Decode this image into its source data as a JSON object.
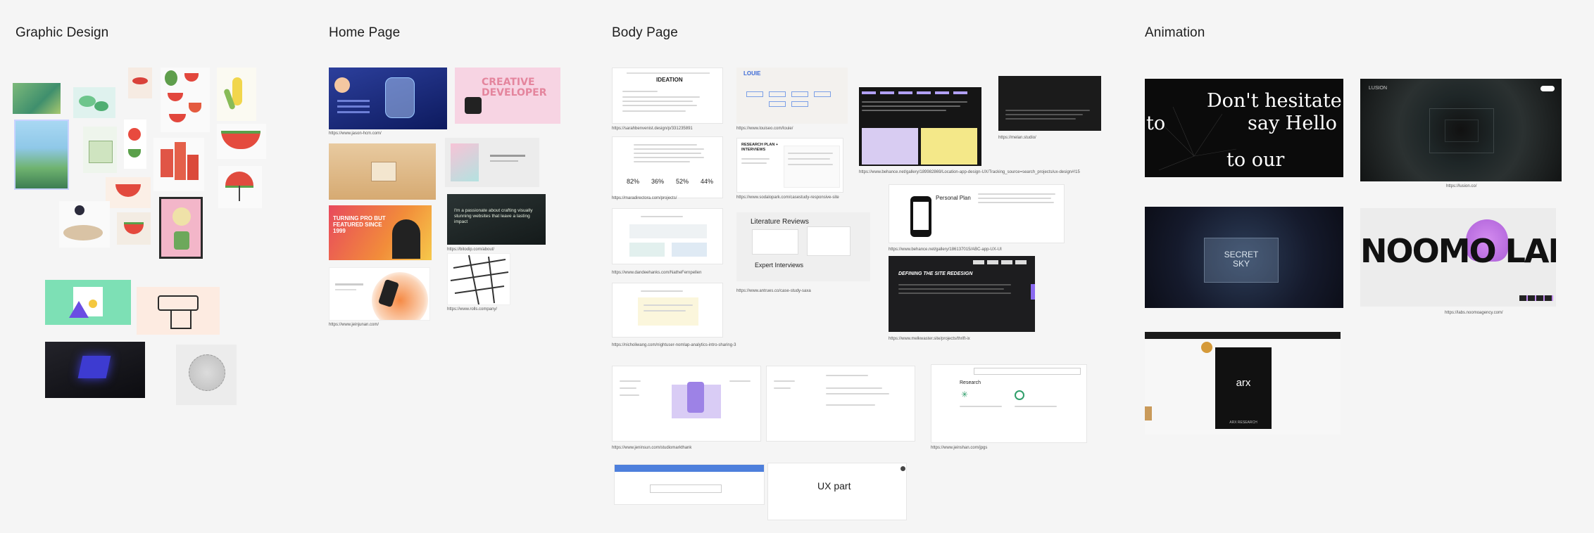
{
  "sections": {
    "graphic": {
      "title": "Graphic Design"
    },
    "home": {
      "title": "Home Page"
    },
    "body": {
      "title": "Body Page"
    },
    "animation": {
      "title": "Animation"
    }
  },
  "home": {
    "creative_text": "CREATIVE DEVELOPER",
    "turning_text": "TURNING PRO BUT FEATURED SINCE 1999",
    "passionate_text": "I'm a passionate about crafting visually stunning websites that leave a lasting impact",
    "captions": {
      "c1": "https://www.jason-hcm.com/",
      "c2": "https://bitodip.com/about/",
      "c3": "https://www.rolls.company/",
      "c4": "https://www.jeinjunan.com/"
    }
  },
  "body": {
    "ideation_title": "IDEATION",
    "louie_title": "LOUIE",
    "research_title": "RESEARCH PLAN + INTERVIEWS",
    "stats": [
      "82%",
      "36%",
      "52%",
      "44%"
    ],
    "lit_review": "Literature Reviews",
    "expert_interviews": "Expert Interviews",
    "personal_plan": "Personal Plan",
    "redesign_title": "DEFINING THE SITE REDESIGN",
    "research_label": "Research",
    "ux_part": "UX part",
    "captions": {
      "c1": "https://sarahbenvenist.design/p/331235891",
      "c2": "https://www.louiseo.com/louie/",
      "c3": "https://www.behance.net/gallery/189982869/Location-app-design-UX/Tracking_source=search_projects/ux-design#!15",
      "c4": "https://melan.studio/",
      "c5": "https://maradirectora.com/projects/",
      "c6": "https://www.sodalopark.com/casestudy-responsive-site",
      "c7": "https://www.behance.net/gallery/186137015/ABC-app-UX-UI",
      "c8": "https://www.dandeehanks.com/NatheFernpellen",
      "c9": "https://www.antrues.co/case-study-saxa",
      "c10": "https://www.melkwaster.site/projects/thrift-ix",
      "c11": "https://nicholiwang.com/nightuser-nomlap-analytics-intro-sharing-3",
      "c12": "https://www.jeninsun.com/studiomarkthank",
      "c13": "https://www.jeinshan.com/jpgs"
    }
  },
  "animation": {
    "hesitate_top": "Don't hesitate",
    "hesitate_left": "to",
    "hesitate_right": "say Hello",
    "hesitate_bottom": "to our",
    "lusion_brand": "LUSION",
    "lusion_caption": "https://lusion.co/",
    "secret_sky": "SECRET SKY",
    "noomo_text": "NOOMO LABS",
    "noomo_caption": "https://labs.noomoagency.com/",
    "arx_text": "arx",
    "arx_sub": "ARX RESEARCH"
  },
  "colors": {
    "background": "#f5f5f5",
    "heading": "#1e1e1e",
    "dark_tile": "#121212",
    "pink": "#f7d4e3",
    "orange": "#f28d3a",
    "purple_soft": "#d8ccf2",
    "yellow": "#f4e889"
  }
}
